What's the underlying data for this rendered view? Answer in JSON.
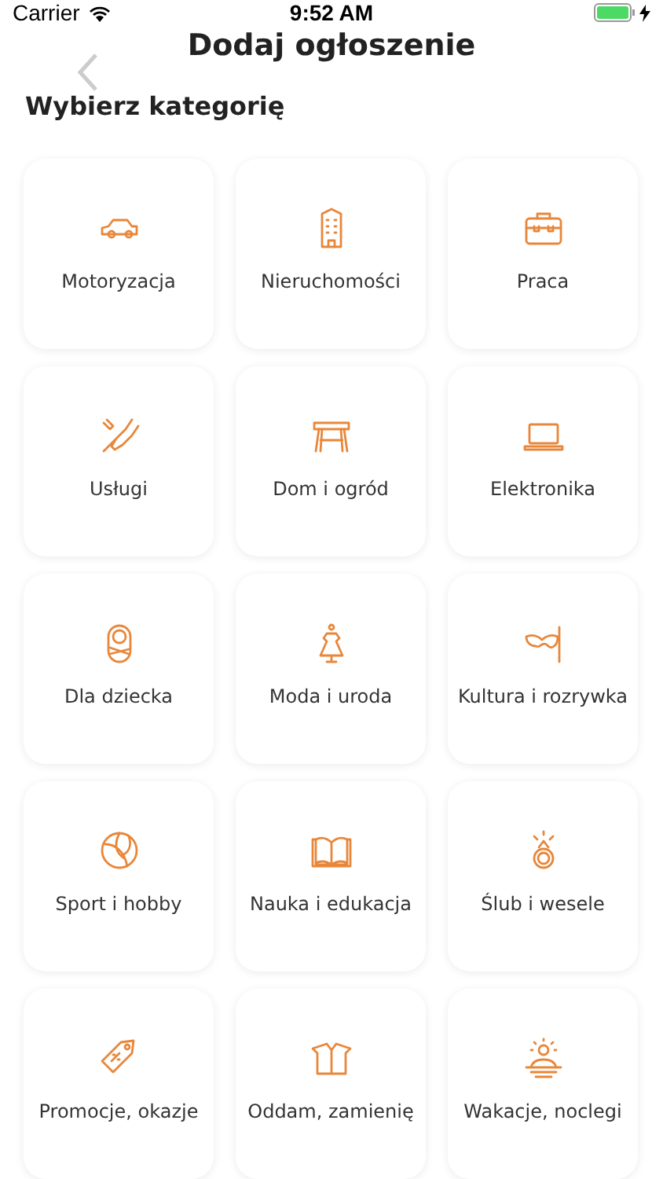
{
  "status_bar": {
    "carrier": "Carrier",
    "time": "9:52 AM",
    "battery_charging": true
  },
  "nav": {
    "title": "Dodaj ogłoszenie"
  },
  "section_title": "Wybierz kategorię",
  "categories": [
    {
      "label": "Motoryzacja"
    },
    {
      "label": "Nieruchomości"
    },
    {
      "label": "Praca"
    },
    {
      "label": "Usługi"
    },
    {
      "label": "Dom i ogród"
    },
    {
      "label": "Elektronika"
    },
    {
      "label": "Dla dziecka"
    },
    {
      "label": "Moda i uroda"
    },
    {
      "label": "Kultura i rozrywka"
    },
    {
      "label": "Sport i hobby"
    },
    {
      "label": "Nauka i edukacja"
    },
    {
      "label": "Ślub i wesele"
    },
    {
      "label": "Promocje, okazje"
    },
    {
      "label": "Oddam, zamienię"
    },
    {
      "label": "Wakacje, noclegi"
    }
  ]
}
